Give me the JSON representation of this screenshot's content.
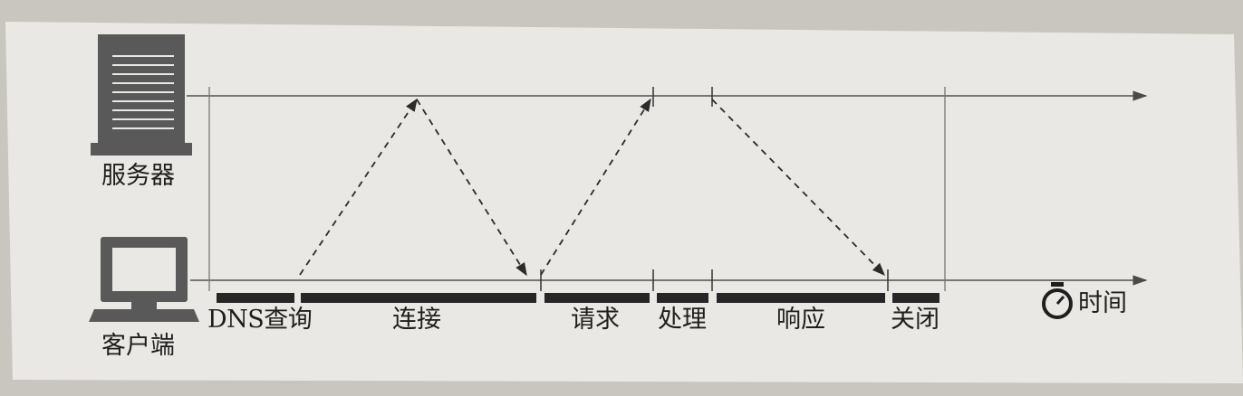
{
  "actors": {
    "server": {
      "label": "服务器",
      "icon": "server-icon"
    },
    "client": {
      "label": "客户端",
      "icon": "computer-icon"
    }
  },
  "time": {
    "label": "时间",
    "icon": "stopwatch-icon"
  },
  "phases": [
    {
      "id": "dns",
      "label": "DNS查询"
    },
    {
      "id": "connect",
      "label": "连接"
    },
    {
      "id": "request",
      "label": "请求"
    },
    {
      "id": "process",
      "label": "处理"
    },
    {
      "id": "response",
      "label": "响应"
    },
    {
      "id": "close",
      "label": "关闭"
    }
  ],
  "messages": [
    {
      "from": "client",
      "to": "server",
      "phase": "connect"
    },
    {
      "from": "server",
      "to": "client",
      "phase": "connect"
    },
    {
      "from": "client",
      "to": "server",
      "phase": "request"
    },
    {
      "from": "server",
      "to": "client",
      "phase": "response"
    }
  ],
  "colors": {
    "paper": "#e9e8e4",
    "ink": "#2b2b2b",
    "bar": "#262626",
    "line": "#6a6a6a"
  }
}
